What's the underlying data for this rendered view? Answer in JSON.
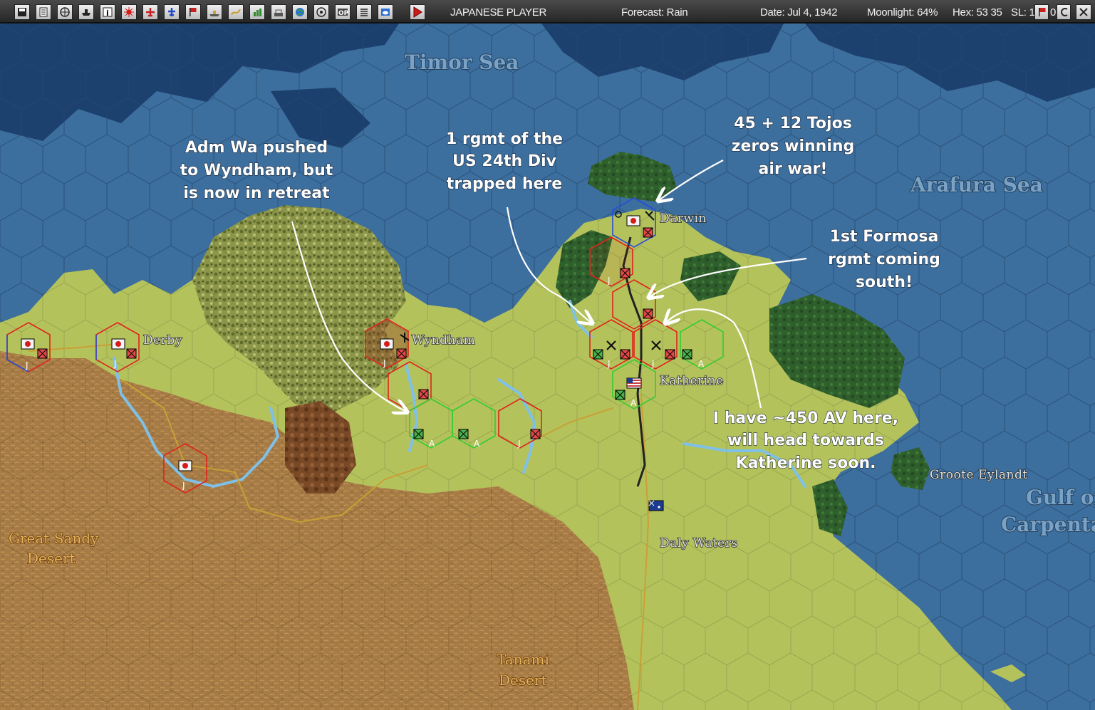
{
  "toolbar": {
    "buttons": [
      {
        "icon": "save-icon"
      },
      {
        "icon": "document-icon"
      },
      {
        "icon": "airgroup-icon"
      },
      {
        "icon": "shipgroup-icon"
      },
      {
        "icon": "info-icon"
      },
      {
        "icon": "rising-sun-icon"
      },
      {
        "icon": "plane-icon"
      },
      {
        "icon": "fighter-icon"
      },
      {
        "icon": "flag-icon"
      },
      {
        "icon": "ship-icon"
      },
      {
        "icon": "route-icon"
      },
      {
        "icon": "chart-icon"
      },
      {
        "icon": "base-icon"
      },
      {
        "icon": "globe-icon"
      },
      {
        "icon": "network-icon"
      },
      {
        "icon": "op-icon"
      },
      {
        "icon": "list-icon"
      },
      {
        "icon": "weather-icon"
      }
    ],
    "play_icon": "play-icon",
    "player": "JAPANESE PLAYER",
    "forecast": "Forecast: Rain",
    "date": "Date: Jul 4, 1942",
    "moonlight": "Moonlight: 64%",
    "hex": "Hex: 53 35",
    "sl": "SL: 1",
    "sl_trail": "0"
  },
  "map": {
    "seas": [
      "Timor Sea",
      "Arafura Sea",
      "Gulf of",
      "Carpentaria"
    ],
    "places": [
      "Darwin",
      "Derby",
      "Wyndham",
      "Katherine",
      "Daly Waters",
      "Groote Eylandt"
    ],
    "deserts": [
      "Great Sandy",
      "Desert",
      "Tanami",
      "Desert"
    ],
    "annotations": {
      "adm_wa": [
        "Adm Wa pushed",
        "to Wyndham, but",
        "is now in retreat"
      ],
      "us_24th": [
        "1 rgmt of the",
        "US 24th Div",
        "trapped here"
      ],
      "tojos": [
        "45 + 12 Tojos",
        "zeros winning",
        "air war!"
      ],
      "formosa": [
        "1st Formosa",
        "rgmt coming",
        "south!"
      ],
      "av": [
        "I have ~450 AV here,",
        "will head towards",
        "Katherine soon."
      ]
    },
    "colors": {
      "sea": "#3c6e9e",
      "deep_water": "#1b3e6b",
      "land": "#b4c25c",
      "desert": "#a67b45",
      "jungle": "#2f5f2c",
      "japan_hex": "#e0241c",
      "allied_hex": "#33cc33",
      "base_hex": "#2a4bd8"
    }
  }
}
